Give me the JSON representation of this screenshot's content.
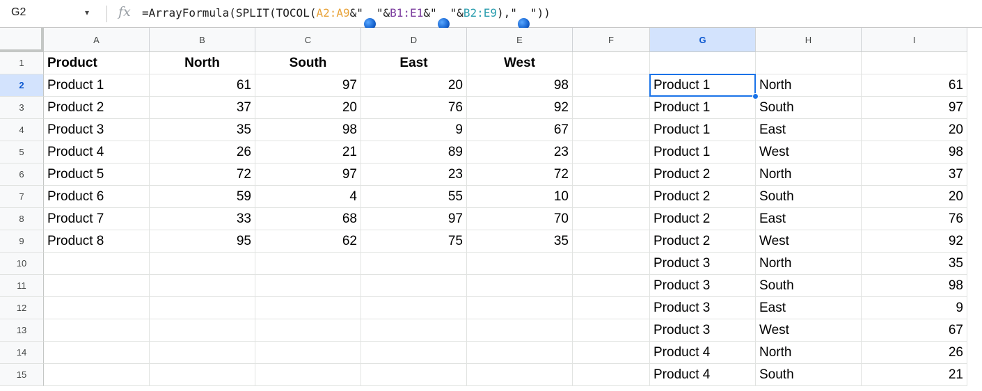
{
  "name_box": {
    "value": "G2",
    "caret": "▾"
  },
  "formula_bar": {
    "fx": "fx",
    "segments": [
      {
        "text": "=ArrayFormula(SPLIT(TOCOL(",
        "color": "default"
      },
      {
        "text": "A2:A9",
        "color": "orange"
      },
      {
        "text": "&\"",
        "color": "default"
      },
      {
        "text": "●",
        "color": "dot"
      },
      {
        "text": "\"&",
        "color": "default"
      },
      {
        "text": "B1:E1",
        "color": "purple"
      },
      {
        "text": "&\"",
        "color": "default"
      },
      {
        "text": "●",
        "color": "dot"
      },
      {
        "text": "\"&",
        "color": "default"
      },
      {
        "text": "B2:E9",
        "color": "teal"
      },
      {
        "text": "),\"",
        "color": "default"
      },
      {
        "text": "●",
        "color": "dot"
      },
      {
        "text": "\"))",
        "color": "default"
      }
    ]
  },
  "columns": [
    "A",
    "B",
    "C",
    "D",
    "E",
    "F",
    "G",
    "H",
    "I"
  ],
  "selected_column": "G",
  "rows": [
    "1",
    "2",
    "3",
    "4",
    "5",
    "6",
    "7",
    "8",
    "9",
    "10",
    "11",
    "12",
    "13",
    "14",
    "15"
  ],
  "selected_row": "2",
  "cells": [
    [
      "Product",
      "North",
      "South",
      "East",
      "West",
      "",
      "",
      "",
      ""
    ],
    [
      "Product 1",
      "61",
      "97",
      "20",
      "98",
      "",
      "Product 1",
      "North",
      "61"
    ],
    [
      "Product 2",
      "37",
      "20",
      "76",
      "92",
      "",
      "Product 1",
      "South",
      "97"
    ],
    [
      "Product 3",
      "35",
      "98",
      "9",
      "67",
      "",
      "Product 1",
      "East",
      "20"
    ],
    [
      "Product 4",
      "26",
      "21",
      "89",
      "23",
      "",
      "Product 1",
      "West",
      "98"
    ],
    [
      "Product 5",
      "72",
      "97",
      "23",
      "72",
      "",
      "Product 2",
      "North",
      "37"
    ],
    [
      "Product 6",
      "59",
      "4",
      "55",
      "10",
      "",
      "Product 2",
      "South",
      "20"
    ],
    [
      "Product 7",
      "33",
      "68",
      "97",
      "70",
      "",
      "Product 2",
      "East",
      "76"
    ],
    [
      "Product 8",
      "95",
      "62",
      "75",
      "35",
      "",
      "Product 2",
      "West",
      "92"
    ],
    [
      "",
      "",
      "",
      "",
      "",
      "",
      "Product 3",
      "North",
      "35"
    ],
    [
      "",
      "",
      "",
      "",
      "",
      "",
      "Product 3",
      "South",
      "98"
    ],
    [
      "",
      "",
      "",
      "",
      "",
      "",
      "Product 3",
      "East",
      "9"
    ],
    [
      "",
      "",
      "",
      "",
      "",
      "",
      "Product 3",
      "West",
      "67"
    ],
    [
      "",
      "",
      "",
      "",
      "",
      "",
      "Product 4",
      "North",
      "26"
    ],
    [
      "",
      "",
      "",
      "",
      "",
      "",
      "Product 4",
      "South",
      "21"
    ]
  ],
  "colors": {
    "selection": "#1a73e8",
    "header_selected_bg": "#d3e3fd",
    "range_orange": "#e8a33a",
    "range_purple": "#7b3c9e",
    "range_teal": "#2a9dae"
  }
}
